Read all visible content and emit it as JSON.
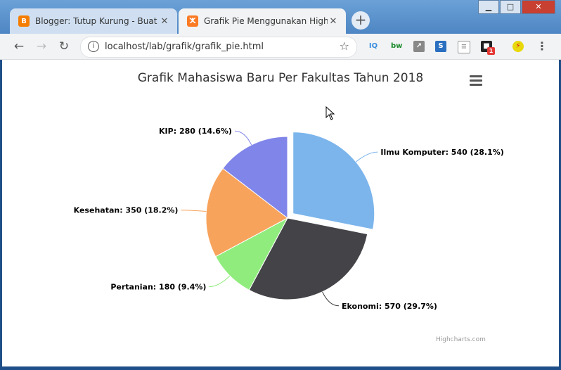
{
  "browser": {
    "tabs": [
      {
        "title": "Blogger: Tutup Kurung - Buat entri",
        "favicon": "blogger-icon"
      },
      {
        "title": "Grafik Pie Menggunakan Highcharts",
        "favicon": "xampp-icon"
      }
    ],
    "url": "localhost/lab/grafik/grafik_pie.html",
    "extension_badge": "1"
  },
  "chart_data": {
    "type": "pie",
    "title": "Grafik Mahasiswa Baru Per Fakultas Tahun 2018",
    "credits": "Highcharts.com",
    "sliced": "Ilmu Komputer",
    "data": [
      {
        "name": "Ilmu Komputer",
        "value": 540,
        "percent": 28.1,
        "color": "#7cb5ec",
        "label": "Ilmu Komputer: 540 (28.1%)"
      },
      {
        "name": "Ekonomi",
        "value": 570,
        "percent": 29.7,
        "color": "#434348",
        "label": "Ekonomi: 570 (29.7%)"
      },
      {
        "name": "Pertanian",
        "value": 180,
        "percent": 9.4,
        "color": "#90ed7d",
        "label": "Pertanian: 180 (9.4%)"
      },
      {
        "name": "Kesehatan",
        "value": 350,
        "percent": 18.2,
        "color": "#f7a35c",
        "label": "Kesehatan: 350 (18.2%)"
      },
      {
        "name": "KIP",
        "value": 280,
        "percent": 14.6,
        "color": "#8085e9",
        "label": "KIP: 280 (14.6%)"
      }
    ]
  }
}
